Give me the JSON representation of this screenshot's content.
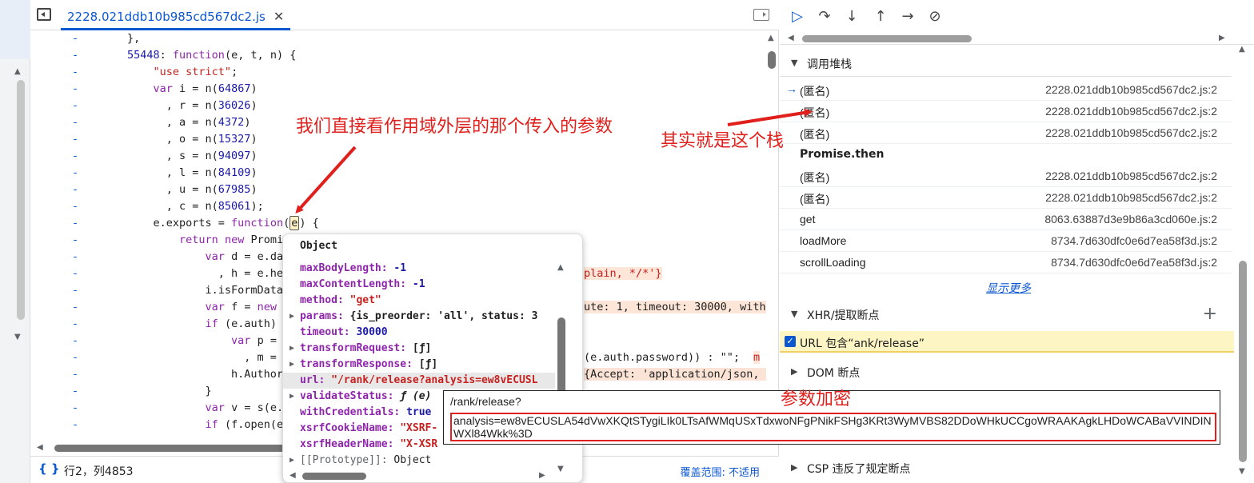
{
  "editor": {
    "tab_title": "2228.021ddb10b985cd567dc2.js",
    "close_glyph": "✕",
    "code_lines": [
      {
        "g": "-",
        "t": "},"
      },
      {
        "g": "-",
        "t": "55448: function(e, t, n) {"
      },
      {
        "g": "-",
        "t": "    \"use strict\";"
      },
      {
        "g": "-",
        "t": "    var i = n(64867)"
      },
      {
        "g": "-",
        "t": "      , r = n(36026)"
      },
      {
        "g": "-",
        "t": "      , a = n(4372)"
      },
      {
        "g": "-",
        "t": "      , o = n(15327)"
      },
      {
        "g": "-",
        "t": "      , s = n(94097)"
      },
      {
        "g": "-",
        "t": "      , l = n(84109)"
      },
      {
        "g": "-",
        "t": "      , u = n(67985)"
      },
      {
        "g": "-",
        "t": "      , c = n(85061);"
      },
      {
        "g": "-",
        "t": "    e.exports = function(e) {"
      },
      {
        "g": "-",
        "t": "        return new Promi"
      },
      {
        "g": "-",
        "t": "            var d = e.da"
      },
      {
        "g": "-",
        "t": "              , h = e.he"
      },
      {
        "g": "-",
        "t": "            i.isFormData"
      },
      {
        "g": "-",
        "t": "            var f = new"
      },
      {
        "g": "-",
        "t": "            if (e.auth)"
      },
      {
        "g": "-",
        "t": "                var p ="
      },
      {
        "g": "-",
        "t": "                  , m ="
      },
      {
        "g": "-",
        "t": "                h.Author"
      },
      {
        "g": "-",
        "t": "            }"
      },
      {
        "g": "-",
        "t": "            var v = s(e."
      },
      {
        "g": "-",
        "t": "            if (f.open(e"
      }
    ],
    "overflow_fragments": {
      "plain": "plain, */*'}",
      "timeout": "ute: 1, timeout: 30000, with",
      "password": "(e.auth.password)) : \"\";",
      "password_tail": "m",
      "accept": "{Accept: 'application/json, t"
    }
  },
  "statusbar": {
    "braces": "{ }",
    "position": "行2，列4853",
    "coverage_label": "覆盖范围:",
    "coverage_value": "不适用"
  },
  "popover": {
    "title": "Object",
    "props": [
      {
        "key": "maxBodyLength",
        "value": "-1",
        "kind": "num",
        "expandable": false
      },
      {
        "key": "maxContentLength",
        "value": "-1",
        "kind": "num",
        "expandable": false
      },
      {
        "key": "method",
        "value": "\"get\"",
        "kind": "str",
        "expandable": false
      },
      {
        "key": "params",
        "value": "{is_preorder: 'all', status: 3",
        "kind": "plain",
        "expandable": true
      },
      {
        "key": "timeout",
        "value": "30000",
        "kind": "num",
        "expandable": false
      },
      {
        "key": "transformRequest",
        "value": "[ƒ]",
        "kind": "plain",
        "expandable": true
      },
      {
        "key": "transformResponse",
        "value": "[ƒ]",
        "kind": "plain",
        "expandable": true
      },
      {
        "key": "url",
        "value": "\"/rank/release?analysis=ew8vECUSL",
        "kind": "str",
        "expandable": false
      },
      {
        "key": "validateStatus",
        "value": "ƒ (e)",
        "kind": "fn",
        "expandable": true
      },
      {
        "key": "withCredentials",
        "value": "true",
        "kind": "bool",
        "expandable": false
      },
      {
        "key": "xsrfCookieName",
        "value": "\"XSRF-",
        "kind": "str",
        "expandable": false
      },
      {
        "key": "xsrfHeaderName",
        "value": "\"X-XSR",
        "kind": "str",
        "expandable": false
      },
      {
        "key": "[[Prototype]]",
        "value": "Object",
        "kind": "plain",
        "expandable": true
      }
    ]
  },
  "url_box": {
    "line1": "/rank/release?",
    "query": "analysis=ew8vECUSLA54dVwXKQtSTygiLIk0LTsAfWMqUSxTdxwoNFgPNikFSHg3KRt3WyMVBS82DDoWHkUCCgoWRAAKAgkLHDoWCABaVVINDINWXl84Wkk%3D"
  },
  "debugger": {
    "call_stack_title": "调用堆栈",
    "frames": [
      {
        "name": "(匿名)",
        "loc": "2228.021ddb10b985cd567dc2.js:2",
        "current": true
      },
      {
        "name": "(匿名)",
        "loc": "2228.021ddb10b985cd567dc2.js:2",
        "current": false
      },
      {
        "name": "(匿名)",
        "loc": "2228.021ddb10b985cd567dc2.js:2",
        "current": false
      },
      {
        "name": "Promise.then",
        "loc": "",
        "async": true
      },
      {
        "name": "(匿名)",
        "loc": "2228.021ddb10b985cd567dc2.js:2",
        "current": false
      },
      {
        "name": "(匿名)",
        "loc": "2228.021ddb10b985cd567dc2.js:2",
        "current": false
      },
      {
        "name": "get",
        "loc": "8063.63887d3e9b86a3cd060e.js:2",
        "current": false
      },
      {
        "name": "loadMore",
        "loc": "8734.7d630dfc0e6d7ea58f3d.js:2",
        "current": false
      },
      {
        "name": "scrollLoading",
        "loc": "8734.7d630dfc0e6d7ea58f3d.js:2",
        "current": false
      }
    ],
    "show_more": "显示更多",
    "xhr_title": "XHR/提取断点",
    "xhr_breakpoint": "URL 包含“ank/release”",
    "dom_title": "DOM 断点",
    "csp_title": "CSP 违反了规定断点",
    "plus": "+"
  },
  "annotations": {
    "scope_note": "我们直接看作用域外层的那个传入的参数",
    "stack_note": "其实就是这个栈",
    "param_note": "参数加密"
  },
  "colors": {
    "accent": "#0b57d0",
    "annotation": "#e0201c",
    "keyword": "#8e24aa",
    "string": "#c5221f"
  }
}
